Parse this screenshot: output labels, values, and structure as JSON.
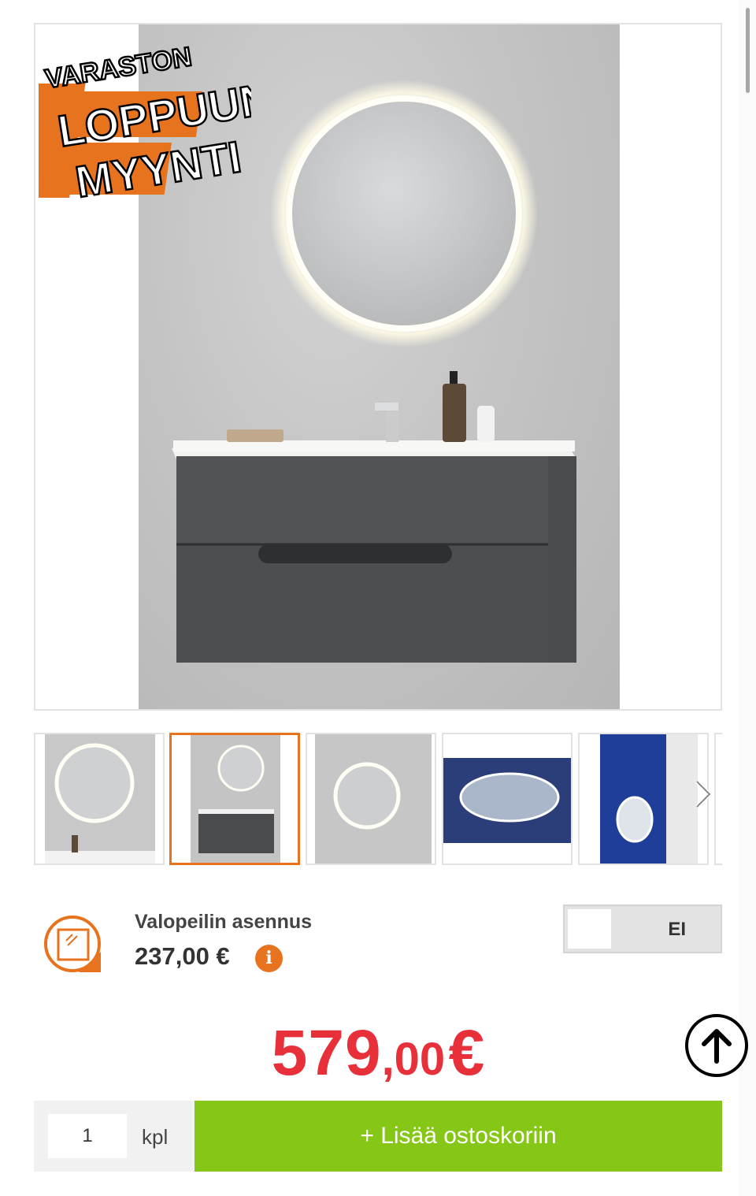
{
  "badge": {
    "line1": "VARASTON",
    "line2": "LOPPUUN-",
    "line3": "MYYNTI"
  },
  "gallery": {
    "selected_index": 1,
    "thumbnail_count": 5
  },
  "installation": {
    "title": "Valopeilin asennus",
    "price": "237,00 €",
    "info_icon": "info-icon",
    "toggle_label": "EI"
  },
  "price": {
    "main": "579",
    "decimals": ",00",
    "currency": "€"
  },
  "cart": {
    "quantity": "1",
    "unit": "kpl",
    "add_label": "+ Lisää ostoskoriin"
  },
  "colors": {
    "accent": "#e8731f",
    "price": "#e8303a",
    "cart_button": "#85c617"
  }
}
